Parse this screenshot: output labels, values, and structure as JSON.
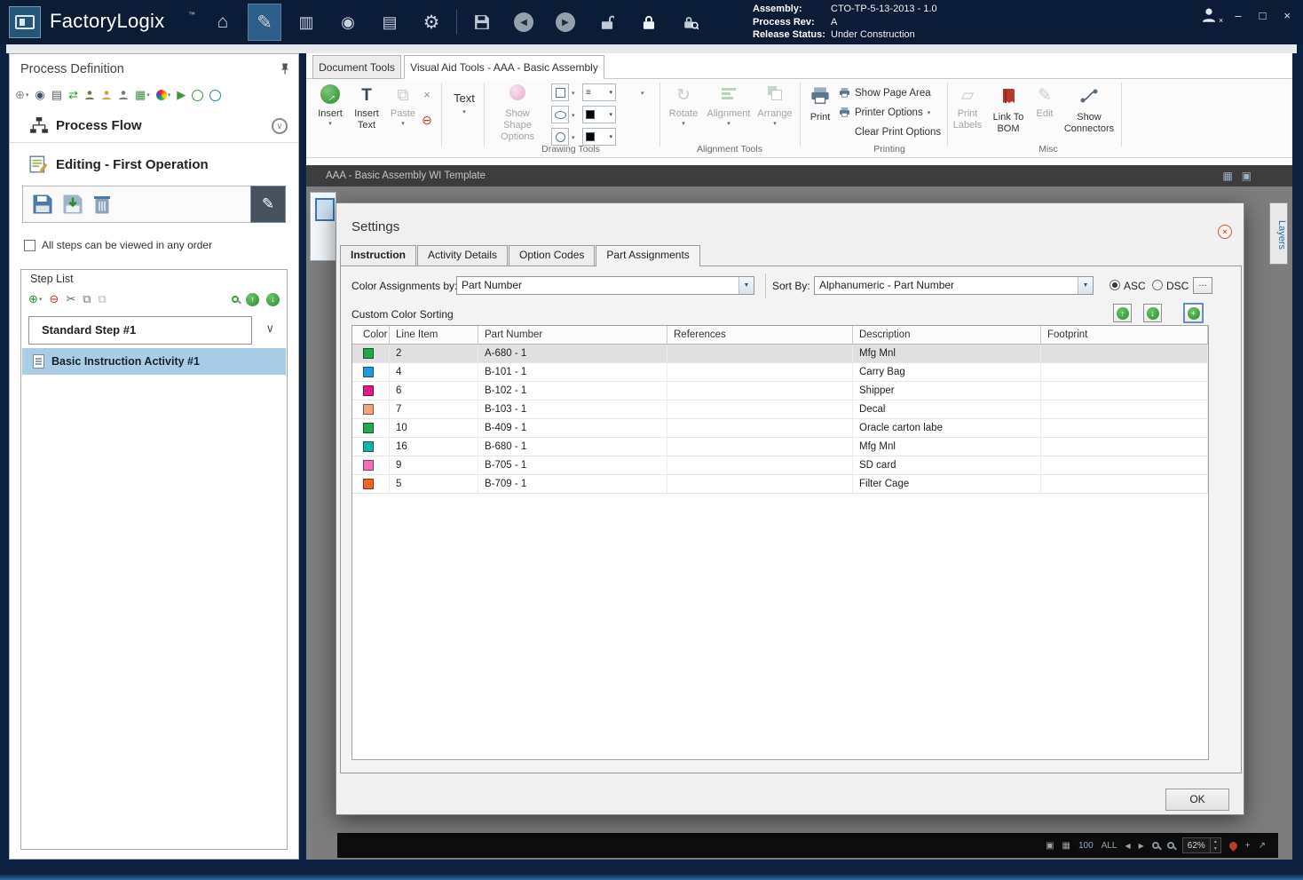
{
  "titlebar": {
    "app_name": "FactoryLogix",
    "trademark": "™",
    "assembly_label": "Assembly:",
    "assembly_value": "CTO-TP-5-13-2013 - 1.0",
    "process_rev_label": "Process Rev:",
    "process_rev_value": "A",
    "release_status_label": "Release Status:",
    "release_status_value": "Under Construction"
  },
  "window_controls": {
    "minimize": "–",
    "maximize": "□",
    "close": "×"
  },
  "sidebar": {
    "title": "Process Definition",
    "process_flow": "Process Flow",
    "editing": "Editing - First Operation",
    "order_checkbox": "All steps can be viewed in any order",
    "step_list_title": "Step List",
    "step_name": "Standard Step #1",
    "activity_name": "Basic Instruction Activity #1"
  },
  "main_tabs": {
    "document_tools": "Document Tools",
    "visual_aid": "Visual Aid Tools - AAA - Basic Assembly"
  },
  "ribbon": {
    "insert": "Insert",
    "insert_text_1": "Insert",
    "insert_text_2": "Text",
    "paste": "Paste",
    "text": "Text",
    "show_shape_1": "Show Shape",
    "show_shape_2": "Options",
    "group_drawing": "Drawing Tools",
    "rotate": "Rotate",
    "alignment": "Alignment",
    "arrange": "Arrange",
    "group_alignment": "Alignment Tools",
    "print": "Print",
    "show_page_area": "Show Page Area",
    "printer_options": "Printer Options",
    "clear_print_options": "Clear Print Options",
    "group_printing": "Printing",
    "print_labels_1": "Print",
    "print_labels_2": "Labels",
    "link_bom_1": "Link To",
    "link_bom_2": "BOM",
    "edit": "Edit",
    "show_conn_1": "Show",
    "show_conn_2": "Connectors",
    "group_misc": "Misc"
  },
  "document": {
    "title": "AAA - Basic Assembly WI Template",
    "layers_tab": "Layers"
  },
  "dialog": {
    "title": "Settings",
    "tabs": [
      "Instruction",
      "Activity Details",
      "Option Codes",
      "Part Assignments"
    ],
    "color_by_label": "Color Assignments by:",
    "color_by_value": "Part Number",
    "sort_by_label": "Sort By:",
    "sort_by_value": "Alphanumeric - Part Number",
    "asc": "ASC",
    "dsc": "DSC",
    "more": "...",
    "custom_sorting": "Custom Color Sorting",
    "ok": "OK",
    "table": {
      "headers": [
        "Color",
        "Line Item",
        "Part Number",
        "References",
        "Description",
        "Footprint"
      ],
      "rows": [
        {
          "color": "#26a44c",
          "line_item": "2",
          "part_number": "A-680 - 1",
          "references": "",
          "description": "Mfg Mnl",
          "footprint": "",
          "selected": true
        },
        {
          "color": "#1f9bdc",
          "line_item": "4",
          "part_number": "B-101 - 1",
          "references": "",
          "description": "Carry Bag",
          "footprint": "",
          "selected": false
        },
        {
          "color": "#e01a86",
          "line_item": "6",
          "part_number": "B-102 - 1",
          "references": "",
          "description": "Shipper",
          "footprint": "",
          "selected": false
        },
        {
          "color": "#f2a47e",
          "line_item": "7",
          "part_number": "B-103 - 1",
          "references": "",
          "description": "Decal",
          "footprint": "",
          "selected": false
        },
        {
          "color": "#28a554",
          "line_item": "10",
          "part_number": "B-409 - 1",
          "references": "",
          "description": "Oracle carton labe",
          "footprint": "",
          "selected": false
        },
        {
          "color": "#12b3a2",
          "line_item": "16",
          "part_number": "B-680 - 1",
          "references": "",
          "description": "Mfg Mnl",
          "footprint": "",
          "selected": false
        },
        {
          "color": "#f06eb6",
          "line_item": "9",
          "part_number": "B-705 - 1",
          "references": "",
          "description": "SD card",
          "footprint": "",
          "selected": false
        },
        {
          "color": "#f26322",
          "line_item": "5",
          "part_number": "B-709 - 1",
          "references": "",
          "description": "Filter Cage",
          "footprint": "",
          "selected": false
        }
      ]
    }
  },
  "statusbar": {
    "page": "100",
    "all": "ALL",
    "zoom": "62%"
  },
  "icons": {
    "home": "⌂",
    "gear": "⚙",
    "pencil": "✎",
    "caret": "▾",
    "chevron_down": "∨",
    "back": "◀",
    "forward": "▶",
    "plus_circle": "⊕",
    "minus_circle": "⊖",
    "scissors": "✂",
    "copy": "⧉",
    "target": "◉",
    "news": "▤",
    "clipboard": "▥",
    "x_mark": "×",
    "dots": "…",
    "rotate": "↻",
    "lines": "≡",
    "arrow_up": "↑",
    "arrow_down": "↓",
    "plus": "+",
    "sync": "⇄",
    "grid": "▦",
    "image": "▣",
    "spin_up": "▲",
    "spin_down": "▼",
    "arrow_ne": "↗",
    "arrow": "→",
    "tag": "▱"
  }
}
